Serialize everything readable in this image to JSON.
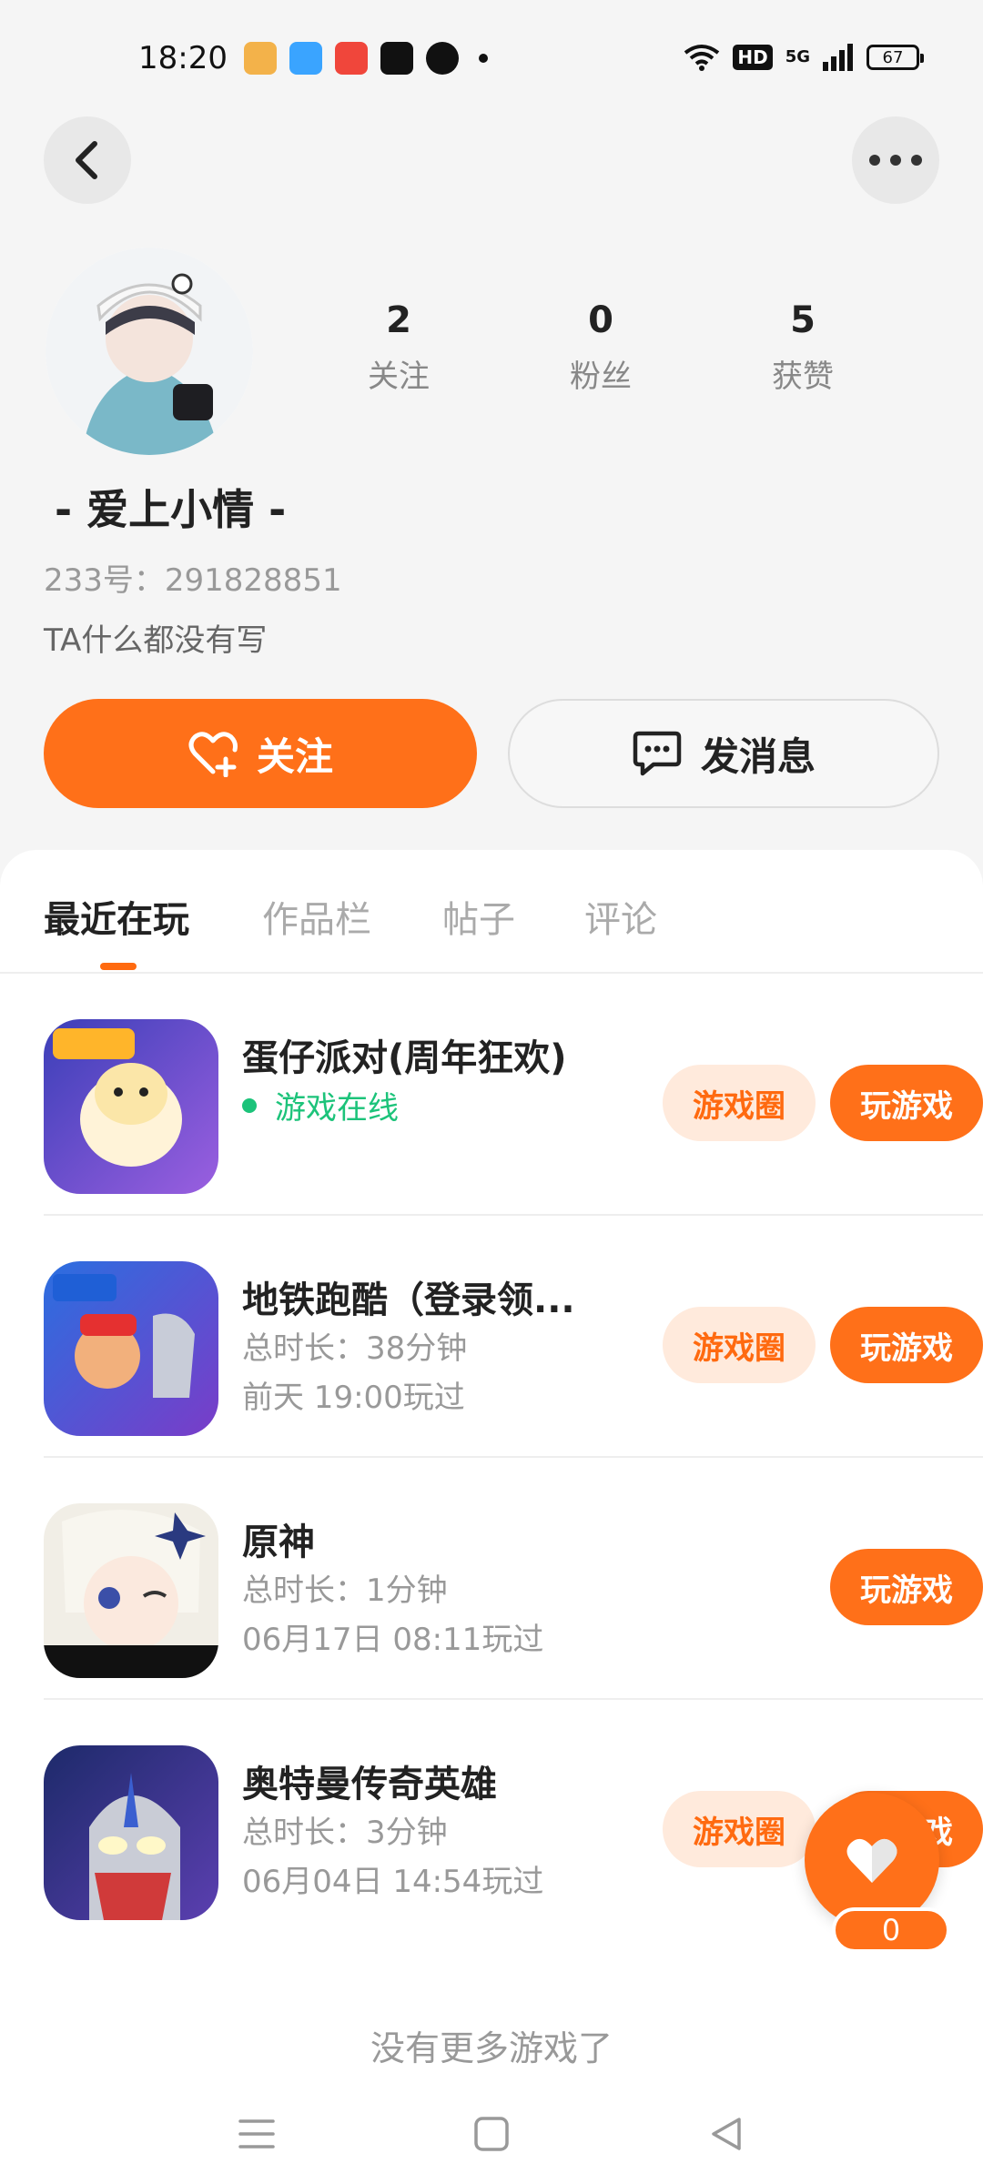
{
  "status_bar": {
    "time": "18:20",
    "hd": "HD",
    "network": "5G",
    "battery": "67"
  },
  "profile": {
    "nickname": "- 爱上小情 -",
    "id_text": "233号：291828851",
    "bio": "TA什么都没有写",
    "stats": [
      {
        "value": "2",
        "label": "关注"
      },
      {
        "value": "0",
        "label": "粉丝"
      },
      {
        "value": "5",
        "label": "获赞"
      }
    ]
  },
  "actions": {
    "follow_label": "关注",
    "message_label": "发消息"
  },
  "tabs": [
    "最近在玩",
    "作品栏",
    "帖子",
    "评论"
  ],
  "games": [
    {
      "name": "蛋仔派对(周年狂欢)",
      "status": "游戏在线",
      "circle_label": "游戏圈",
      "play_label": "玩游戏"
    },
    {
      "name": "地铁跑酷（登录领...",
      "duration": "总时长：38分钟",
      "last_played": "前天 19:00玩过",
      "circle_label": "游戏圈",
      "play_label": "玩游戏"
    },
    {
      "name": "原神",
      "duration": "总时长：1分钟",
      "last_played": "06月17日 08:11玩过",
      "play_label": "玩游戏"
    },
    {
      "name": "奥特曼传奇英雄",
      "duration": "总时长：3分钟",
      "last_played": "06月04日 14:54玩过",
      "circle_label": "游戏圈",
      "play_label": "玩游戏"
    }
  ],
  "footer": {
    "no_more": "没有更多游戏了"
  },
  "like_fab": {
    "count": "0"
  },
  "colors": {
    "accent": "#ff7019",
    "online": "#1cc37a",
    "circle_bg": "#ffeadc"
  }
}
